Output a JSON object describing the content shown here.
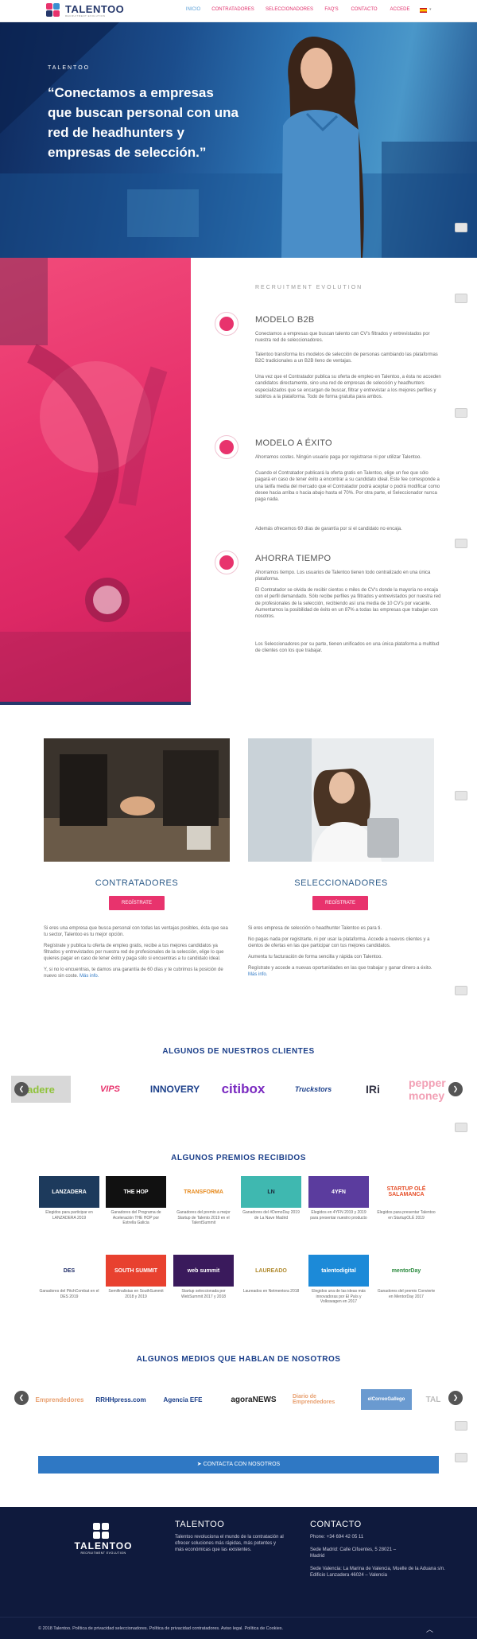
{
  "header": {
    "logo_text": "TALENTOO",
    "logo_sub": "RECRUITMENT EVOLUTION",
    "nav": [
      "INICIO",
      "CONTRATADORES",
      "SELECCIONADORES",
      "FAQ'S",
      "CONTACTO",
      "ACCEDE"
    ],
    "lang_flag": "ES"
  },
  "hero": {
    "tag": "TALENTOO",
    "quote": "“Conectamos a empresas que buscan personal con una red de headhunters y empresas de selección.”"
  },
  "recruitment": {
    "label": "RECRUITMENT EVOLUTION",
    "features": [
      {
        "title": "MODELO B2B",
        "icon": "briefcase-icon",
        "paragraphs": [
          "Conectamos a empresas que buscan talento con CV's filtrados y entrevistados por nuestra red de seleccionadores.",
          "Talentoo transforma los modelos de selección de personas cambiando las plataformas B2C tradicionales a un B2B lleno de ventajas.",
          "Una vez que el Contratador publica su oferta de empleo en Talentoo, a ésta no acceden candidatos directamente, sino una red de empresas de selección y headhunters especializados que se encargan de buscar, filtrar y entrevistar a los mejores perfiles y subirlos a la plataforma. Todo de forma gratuita para ambos."
        ]
      },
      {
        "title": "MODELO A ÉXITO",
        "icon": "trophy-icon",
        "paragraphs": [
          "Ahorramos costes. Ningún usuario paga por registrarse ni por utilizar Talentoo.",
          "Cuando el Contratador publicará la oferta gratis en Talentoo, elige un fee que sólo pagará en caso de tener éxito a encontrar a su candidato ideal. Este fee corresponde a una tarifa media del mercado que el Contratador podrá aceptar o podrá modificar como desee hacia arriba o hacia abajo hasta el 70%. Por otra parte, el Seleccionador nunca paga nada.",
          "Además ofrecemos 60 días de garantía por si el candidato no encaja."
        ]
      },
      {
        "title": "AHORRA TIEMPO",
        "icon": "clock-icon",
        "paragraphs": [
          "Ahorramos tiempo. Los usuarios de Talentoo tienen todo centralizado en una única plataforma.",
          "El Contratador se olvida de recibir cientos o miles de CV's donde la mayoría no encaja con el perfil demandado. Sólo recibe perfiles ya filtrados y entrevistados por nuestra red de profesionales de la selección, recibiendo así una media de 10 CV's por vacante. Aumentamos la posibilidad de éxito en un 87% a todas las empresas que trabajan con nosotros.",
          "Los Seleccionadores por su parte, tienen unificados en una única plataforma a multitud de clientes con los que trabajar."
        ]
      }
    ]
  },
  "columns": {
    "contratadores": {
      "title": "CONTRATADORES",
      "button": "REGÍSTRATE",
      "paragraphs": [
        "Si eres una empresa que busca personal con todas las ventajas posibles, ésta que sea tu sector, Talentoo es tu mejor opción.",
        "Regístrate y publica tu oferta de empleo gratis, recibe a tus mejores candidatos ya filtrados y entrevistados por nuestra red de profesionales de la selección, elige lo que quieres pagar en caso de tener éxito y paga sólo si encuentras a tu candidato ideal.",
        "Y, si no lo encuentras, te damos una garantía de 60 días y te cubrimos la posición de nuevo sin coste."
      ],
      "more": "Más info."
    },
    "seleccionadores": {
      "title": "SELECCIONADORES",
      "button": "REGÍSTRATE",
      "paragraphs": [
        "Si eres empresa de selección o headhunter Talentoo es para ti.",
        "No pagas nada por registrarte, ni por usar la plataforma. Accede a nuevos clientes y a cientos de ofertas en las que participar con tus mejores candidatos.",
        "Aumenta tu facturación de forma sencilla y rápida con Talentoo.",
        "Regístrate y accede a nuevas oportunidades en las que trabajar y ganar dinero a éxito."
      ],
      "more": "Más info."
    }
  },
  "clients": {
    "title": "ALGUNOS DE NUESTROS CLIENTES",
    "logos": [
      "adere",
      "VIPS",
      "INNOVERY",
      "citibox",
      "Truckstors",
      "IRi",
      "pepper money"
    ]
  },
  "awards": {
    "title": "ALGUNOS PREMIOS RECIBIDOS",
    "items": [
      {
        "logo": "LANZADERA",
        "caption": "Elegidos para participar en LANZADERA 2019",
        "color": "#1d3a5c",
        "text_color": "#fff"
      },
      {
        "logo": "THE HOP",
        "caption": "Ganadores del Programa de Aceleración THE HOP por Estrella Galicia",
        "color": "#111",
        "text_color": "#fff"
      },
      {
        "logo": "TRANSFORMA",
        "caption": "Ganadores del premio a mejor Startup de Talento 2019 en el TalentSummit",
        "color": "#fff",
        "text_color": "#e68a1e"
      },
      {
        "logo": "LN",
        "caption": "Ganadores del #DemoDay 2019 de La Nave Madrid",
        "color": "#3fb8b0",
        "text_color": "#1b2a3a"
      },
      {
        "logo": "4YFN",
        "caption": "Elegidos en 4YFN 2019 y 2019 para presentar nuestro producto",
        "color": "#5b3c9e",
        "text_color": "#fff"
      },
      {
        "logo": "STARTUP OLÉ SALAMANCA",
        "caption": "Elegidos para presentar Talentoo en StartupOLÉ 2019",
        "color": "#fff",
        "text_color": "#e6502a"
      },
      {
        "logo": "DES",
        "caption": "Ganadores del PitchCombat en el DES 2019",
        "color": "#fff",
        "text_color": "#1d2a66"
      },
      {
        "logo": "SOUTH SUMMIT",
        "caption": "Semifinalistas en SouthSummit 2018 y 2019",
        "color": "#e8412f",
        "text_color": "#fff"
      },
      {
        "logo": "web summit",
        "caption": "Startup seleccionada por WebSummit 2017 y 2018",
        "color": "#3a1a5c",
        "text_color": "#fff"
      },
      {
        "logo": "LAUREADO",
        "caption": "Laureados en Netmentora 2018",
        "color": "#fff",
        "text_color": "#b08a2e"
      },
      {
        "logo": "talentodigital",
        "caption": "Elegidos una de las ideas más innovadoras por El País y Volkswagen en 2017",
        "color": "#1c8ad8",
        "text_color": "#fff"
      },
      {
        "logo": "mentorDay",
        "caption": "Ganadores del premio Convierte en MentorDay 2017",
        "color": "#fff",
        "text_color": "#2b8a3e"
      }
    ]
  },
  "media": {
    "title": "ALGUNOS MEDIOS QUE HABLAN DE NOSOTROS",
    "logos": [
      "Emprendedores",
      "RRHHpress.com",
      "Agencia EFE",
      "agoraNEWS",
      "Diario de Emprendedores",
      "elCorreoGallego",
      "TAL"
    ]
  },
  "contact_button": "CONTACTA CON NOSOTROS",
  "footer": {
    "logo_text": "TALENTOO",
    "logo_sub": "RECRUITMENT EVOLUTION",
    "about_title": "TALENTOO",
    "about_text": "Talentoo revoluciona el mundo de la contratación al ofrecer soluciones más rápidas, más potentes y más económicas que las existentes.",
    "contact_title": "CONTACTO",
    "phone": "Phone: +34 694 42 05 11",
    "madrid": "Sede Madrid: Calle Cifuentes, 5 28021 – Madrid",
    "valencia": "Sede Valencia: La Marina de Valencia, Muelle de la Aduana s/n. Edificio Lanzadera 46024 – Valencia",
    "copyright": "© 2018 Talentoo. Política de privacidad seleccionadores. Política de privacidad contratadores. Aviso legal. Política de Cookies."
  },
  "colors": {
    "pink": "#e8336d",
    "navy": "#0f1a3d",
    "blue": "#2f78c4",
    "title_blue": "#1b3f8a"
  }
}
